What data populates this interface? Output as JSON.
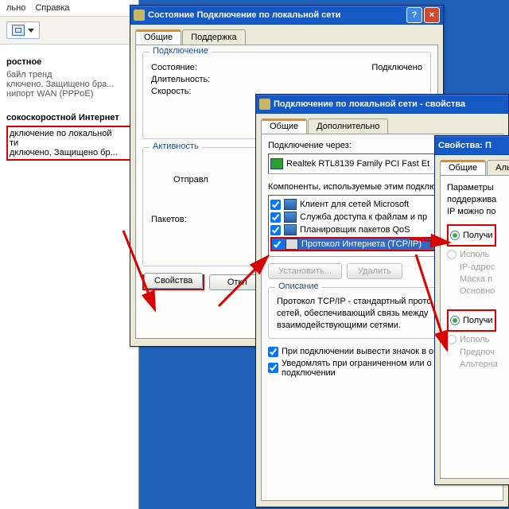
{
  "leftpanel": {
    "menu": [
      "льно",
      "Справка"
    ],
    "section1_head": "ростное",
    "section1_lines": [
      "байл тренд",
      "ключено, Защищено бра...",
      "нипорт WAN (PPPoE)"
    ],
    "section2_head": "сокоскоростной Интернет",
    "item_lines": [
      "дключение по локальной",
      "ти",
      "дключено, Защищено бр..."
    ]
  },
  "statuswin": {
    "title": "Состояние Подключение по локальной сети",
    "tabs": [
      "Общие",
      "Поддержка"
    ],
    "grp_conn": "Подключение",
    "lbl_state": "Состояние:",
    "val_state": "Подключено",
    "lbl_dur": "Длительность:",
    "lbl_speed": "Скорость:",
    "grp_act": "Активность",
    "lbl_sent": "Отправл",
    "lbl_pkts": "Пакетов:",
    "btn_props": "Свойства",
    "btn_off": "Откл"
  },
  "propswin": {
    "title": "Подключение по локальной сети - свойства",
    "tabs": [
      "Общие",
      "Дополнительно"
    ],
    "lbl_via": "Подключение через:",
    "adapter": "Realtek RTL8139 Family PCI Fast Et",
    "lbl_comps": "Компоненты, используемые этим подклю",
    "items": [
      "Клиент для сетей Microsoft",
      "Служба доступа к файлам и пр",
      "Планировщик пакетов QoS",
      "Протокол Интернета (TCP/IP)"
    ],
    "btn_install": "Установить...",
    "btn_remove": "Удалить",
    "grp_desc": "Описание",
    "desc": "Протокол TCP/IP - стандартный прото­сетей, обеспечивающий связь между­взаимодействующими сетями.",
    "chk_tray": "При подключении вывести значок в о",
    "chk_notify": "Уведомлять при ограниченном или о подключении"
  },
  "tcpwin": {
    "title": "Свойства: П",
    "tabs": [
      "Общие",
      "Аль"
    ],
    "para": "Параметры\nподдержива\nIP можно по",
    "r_auto_ip": "Получи",
    "r_man_ip": "Исполь",
    "lbl_ip": "IP-адрес",
    "lbl_mask": "Маска п",
    "lbl_gw": "Основно",
    "r_auto_dns": "Получи",
    "r_man_dns": "Исполь",
    "lbl_pdns": "Предпоч",
    "lbl_adns": "Альтерна"
  }
}
